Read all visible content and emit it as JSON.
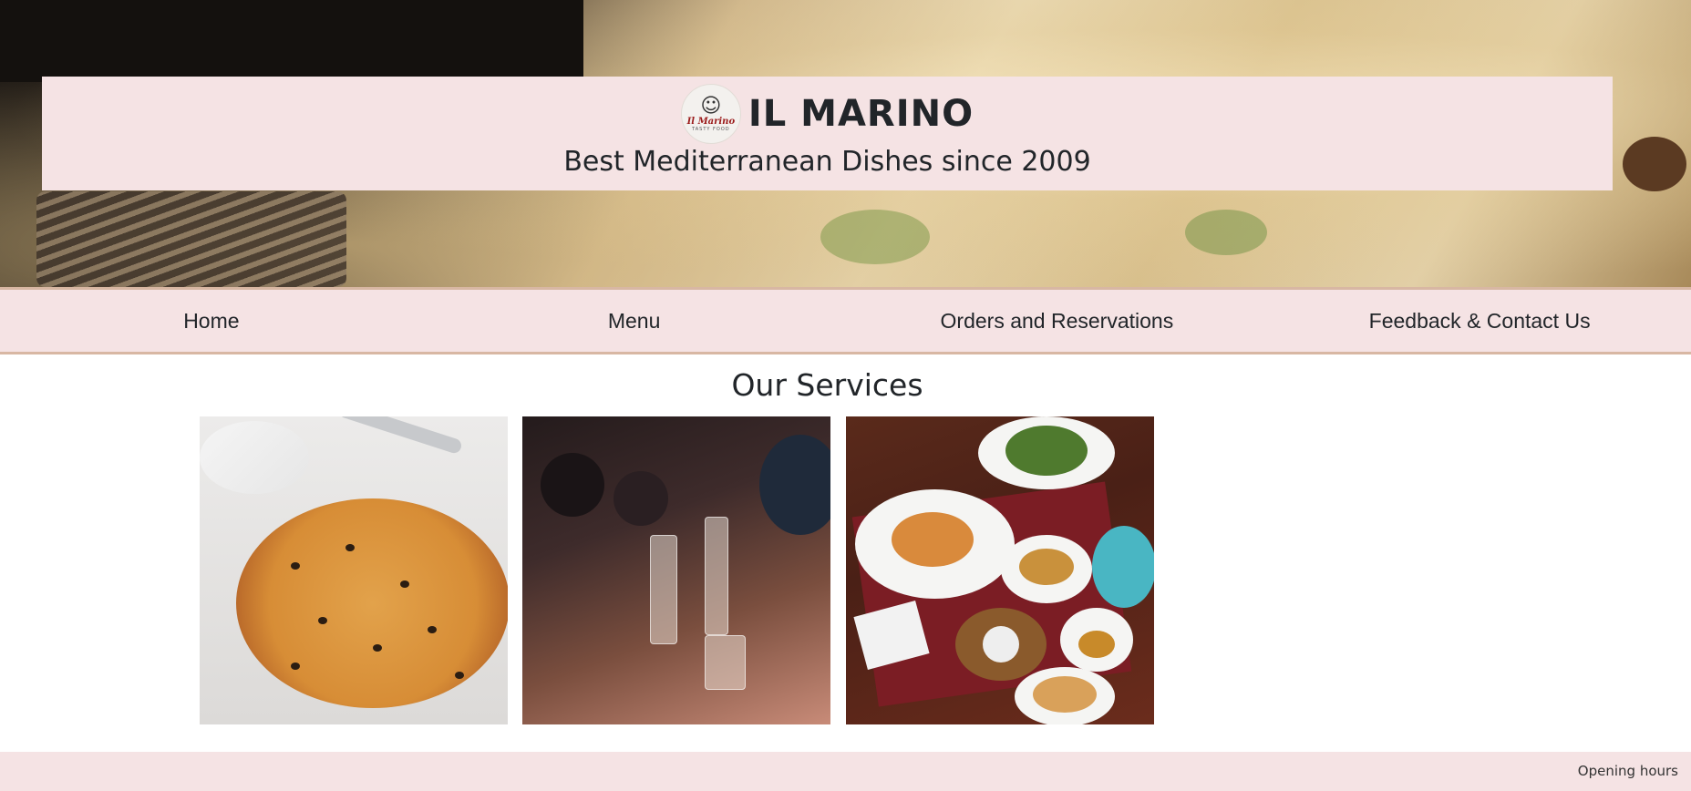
{
  "header": {
    "logo_script": "Il Marino",
    "logo_subtitle": "TASTY FOOD",
    "brand_name": "IL MARINO",
    "tagline": "Best Mediterranean Dishes since 2009"
  },
  "nav": {
    "items": [
      {
        "label": "Home"
      },
      {
        "label": "Menu"
      },
      {
        "label": "Orders and Reservations"
      },
      {
        "label": "Feedback & Contact Us"
      }
    ]
  },
  "services": {
    "title": "Our Services",
    "tiles": [
      {
        "image": "pizza-photo"
      },
      {
        "image": "people-dining-photo"
      },
      {
        "image": "table-dishes-photo"
      }
    ]
  },
  "footer": {
    "opening_hours": "Opening hours"
  },
  "colors": {
    "band": "#f5e3e4",
    "nav_border": "#d8b7a3",
    "text": "#212529"
  }
}
